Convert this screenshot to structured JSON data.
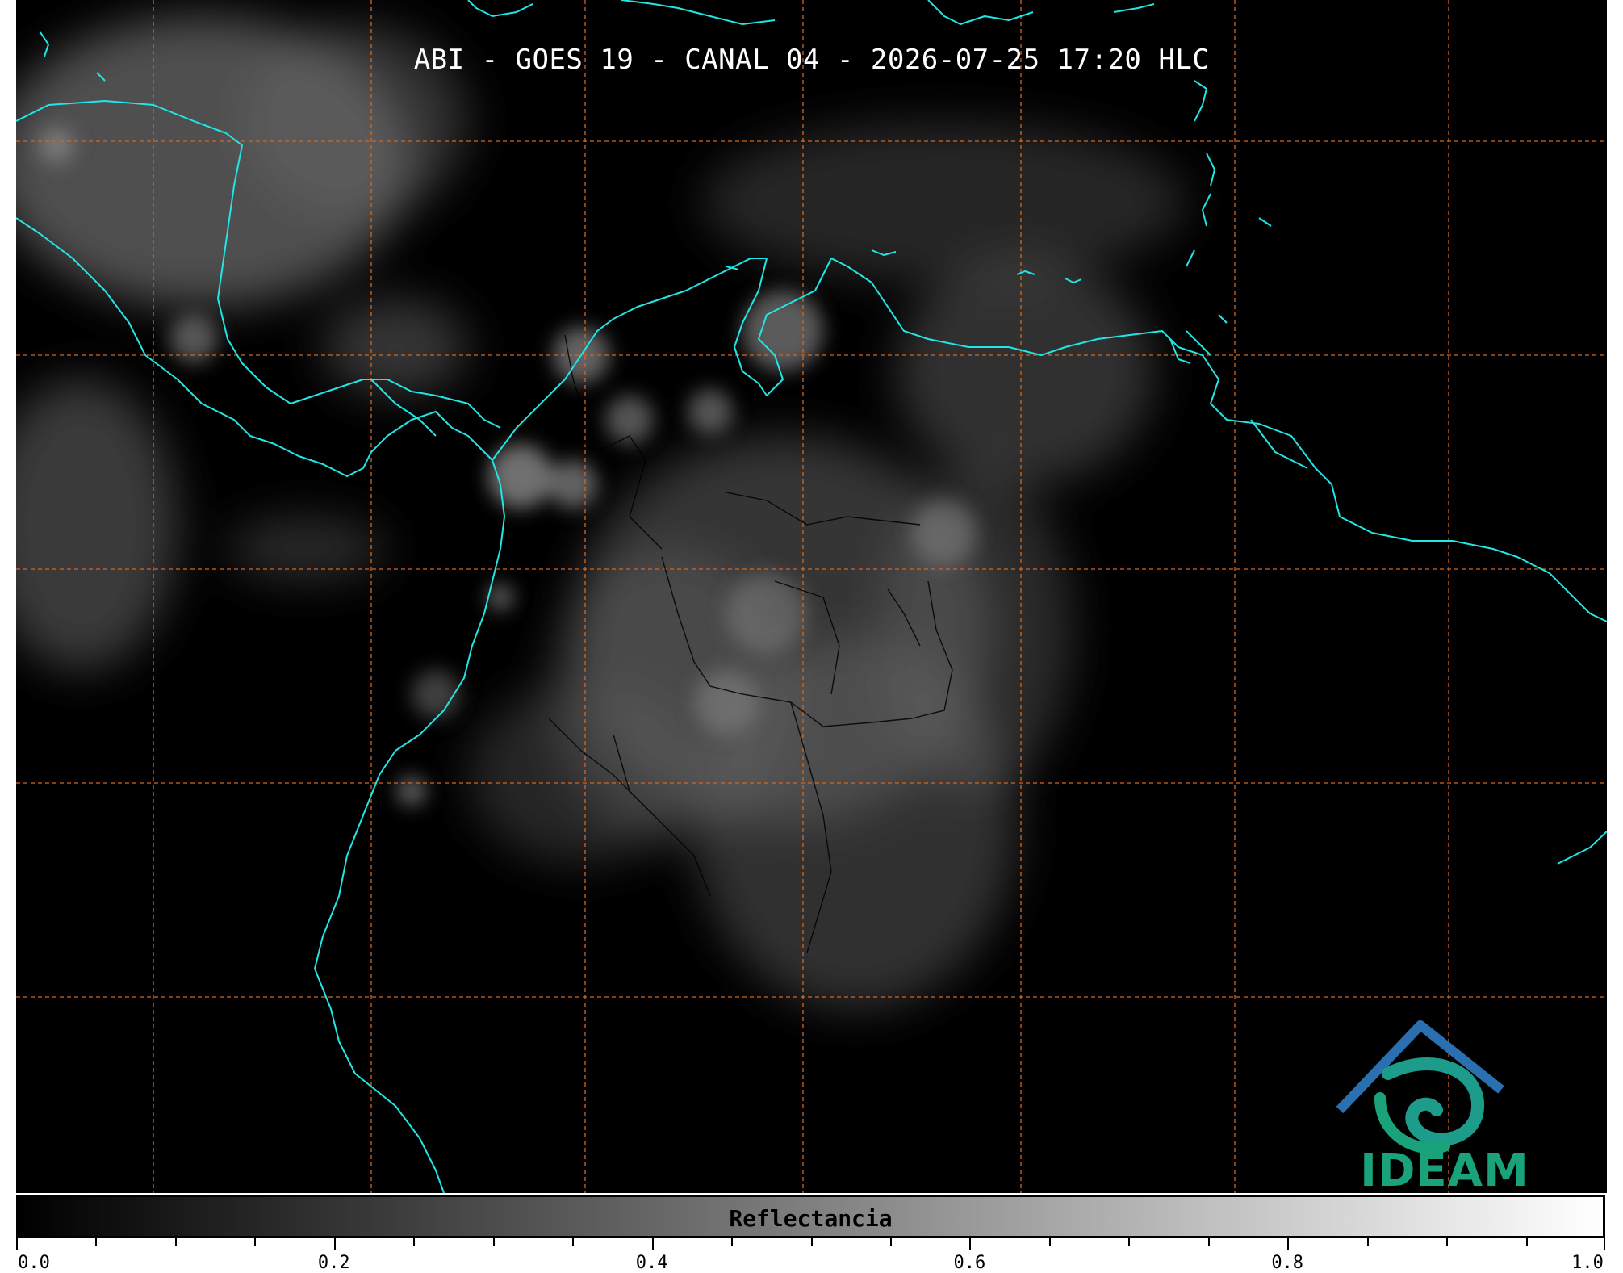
{
  "title": "ABI - GOES 19 - CANAL 04 - 2026-07-25 17:20 HLC",
  "colorbar": {
    "label": "Reflectancia",
    "min": 0.0,
    "max": 1.0,
    "tick_labels": [
      "0.0",
      "0.2",
      "0.4",
      "0.6",
      "0.8",
      "1.0"
    ],
    "gradient": [
      "#000000",
      "#ffffff"
    ]
  },
  "logo": {
    "text": "IDEAM",
    "colors": [
      "#2a4fa8",
      "#1aa37a"
    ]
  },
  "colors": {
    "background": "#000000",
    "coastline": "#21e6e6",
    "borders": "#000000",
    "graticule": "#d2691e"
  },
  "graticule": {
    "style": "dashed"
  },
  "icons": [
    "ideam-logo"
  ]
}
